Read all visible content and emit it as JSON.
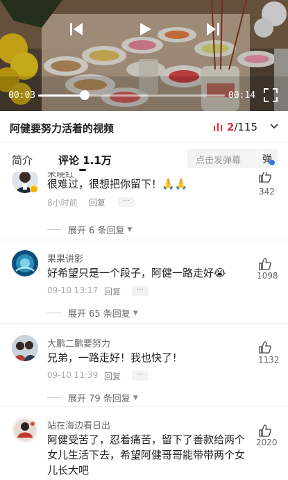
{
  "player": {
    "current_time": "00:03",
    "total_time": "00:14",
    "progress": 0.25
  },
  "video": {
    "title": "阿健要努力活着的视频",
    "episode_current": "2",
    "episode_total": "/115"
  },
  "tabs": {
    "intro": "简介",
    "comments": "评论 1.1万"
  },
  "danmu": {
    "placeholder": "点击发弹幕",
    "button": "弹"
  },
  "comments": [
    {
      "name": "禾晓红",
      "text": "很难过，很想把你留下！🙏🙏",
      "time": "8小时前",
      "reply": "回复",
      "likes": "342",
      "expand": "展开 6 条回复"
    },
    {
      "name": "果果讲影",
      "text": "好希望只是一个段子，阿健一路走好😭",
      "time": "09-10 13:17",
      "reply": "回复",
      "likes": "1098",
      "expand": "展开 65 条回复"
    },
    {
      "name": "大鹏二鹏要努力",
      "text": "兄弟，一路走好！我也快了！",
      "time": "09-10 11:39",
      "reply": "回复",
      "likes": "1132",
      "expand": "展开 79 条回复"
    },
    {
      "name": "站在海边看日出",
      "text": "阿健受苦了，忍着痛苦，留下了善款给两个女儿生活下去，希望阿健哥哥能带带两个女儿长大吧",
      "likes": "2020"
    }
  ],
  "colors": {
    "accent_red": "#e0323c",
    "danmu_blue": "#2b7ce9"
  },
  "icons": [
    "prev-icon",
    "play-icon",
    "next-icon",
    "fullscreen-icon",
    "bars-icon",
    "chevron-down-icon",
    "like-icon",
    "more-icon"
  ]
}
